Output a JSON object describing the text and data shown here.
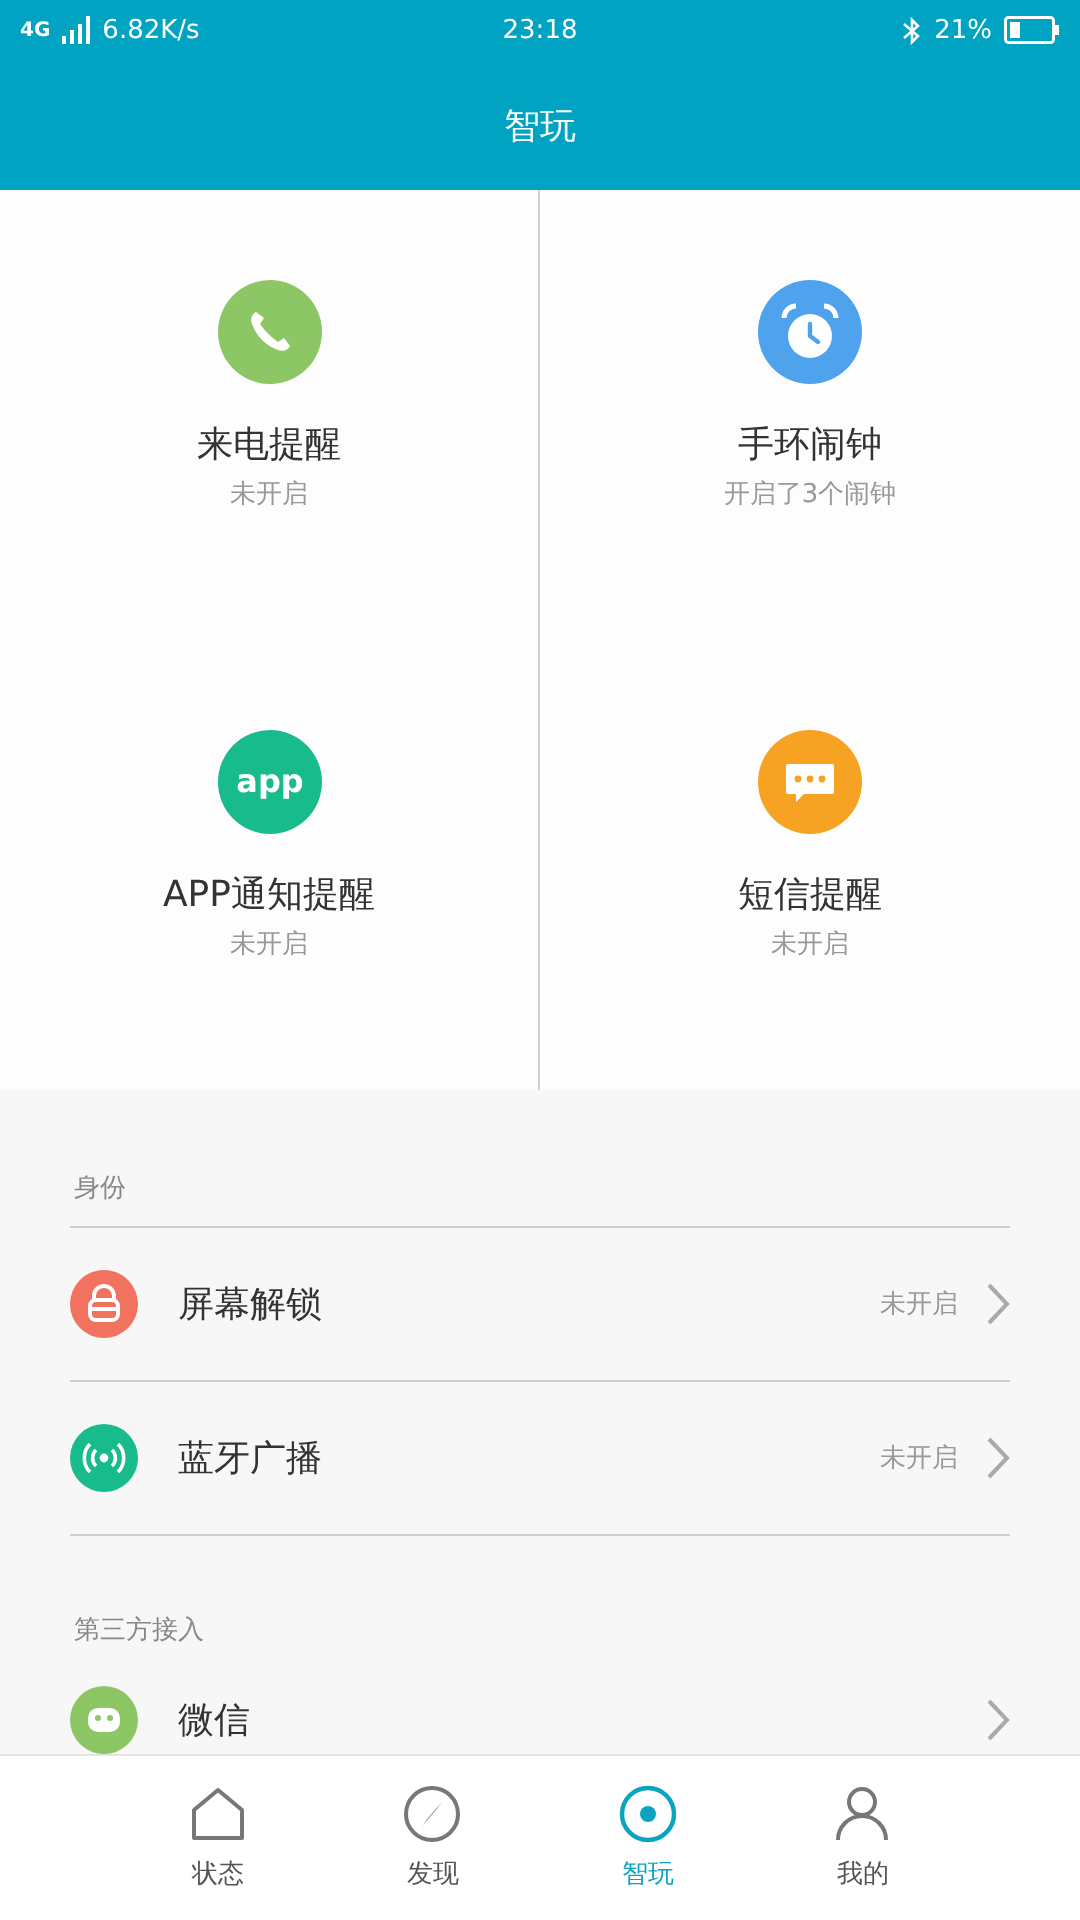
{
  "status_bar": {
    "network": "4G",
    "speed": "6.82K/s",
    "time": "23:18",
    "battery": "21%"
  },
  "title": "智玩",
  "features": [
    {
      "kind": "phone",
      "color": "#8cc665",
      "title": "来电提醒",
      "status": "未开启"
    },
    {
      "kind": "alarm",
      "color": "#4ea3ec",
      "title": "手环闹钟",
      "status": "开启了3个闹钟"
    },
    {
      "kind": "app",
      "color": "#17bb8c",
      "icon_text": "app",
      "title": "APP通知提醒",
      "status": "未开启"
    },
    {
      "kind": "message",
      "color": "#f6a323",
      "title": "短信提醒",
      "status": "未开启"
    }
  ],
  "sections": [
    {
      "header": "身份",
      "rows": [
        {
          "kind": "lock",
          "color": "#f0725f",
          "title": "屏幕解锁",
          "status": "未开启"
        },
        {
          "kind": "broadcast",
          "color": "#17bb8c",
          "title": "蓝牙广播",
          "status": "未开启"
        }
      ]
    },
    {
      "header": "第三方接入",
      "rows": [
        {
          "kind": "wechat",
          "color": "#8cc665",
          "title": "微信"
        }
      ]
    }
  ],
  "tabs": [
    {
      "kind": "home",
      "label": "状态",
      "selected": false
    },
    {
      "kind": "compass",
      "label": "发现",
      "selected": false
    },
    {
      "kind": "target",
      "label": "智玩",
      "selected": true
    },
    {
      "kind": "person",
      "label": "我的",
      "selected": false
    }
  ]
}
